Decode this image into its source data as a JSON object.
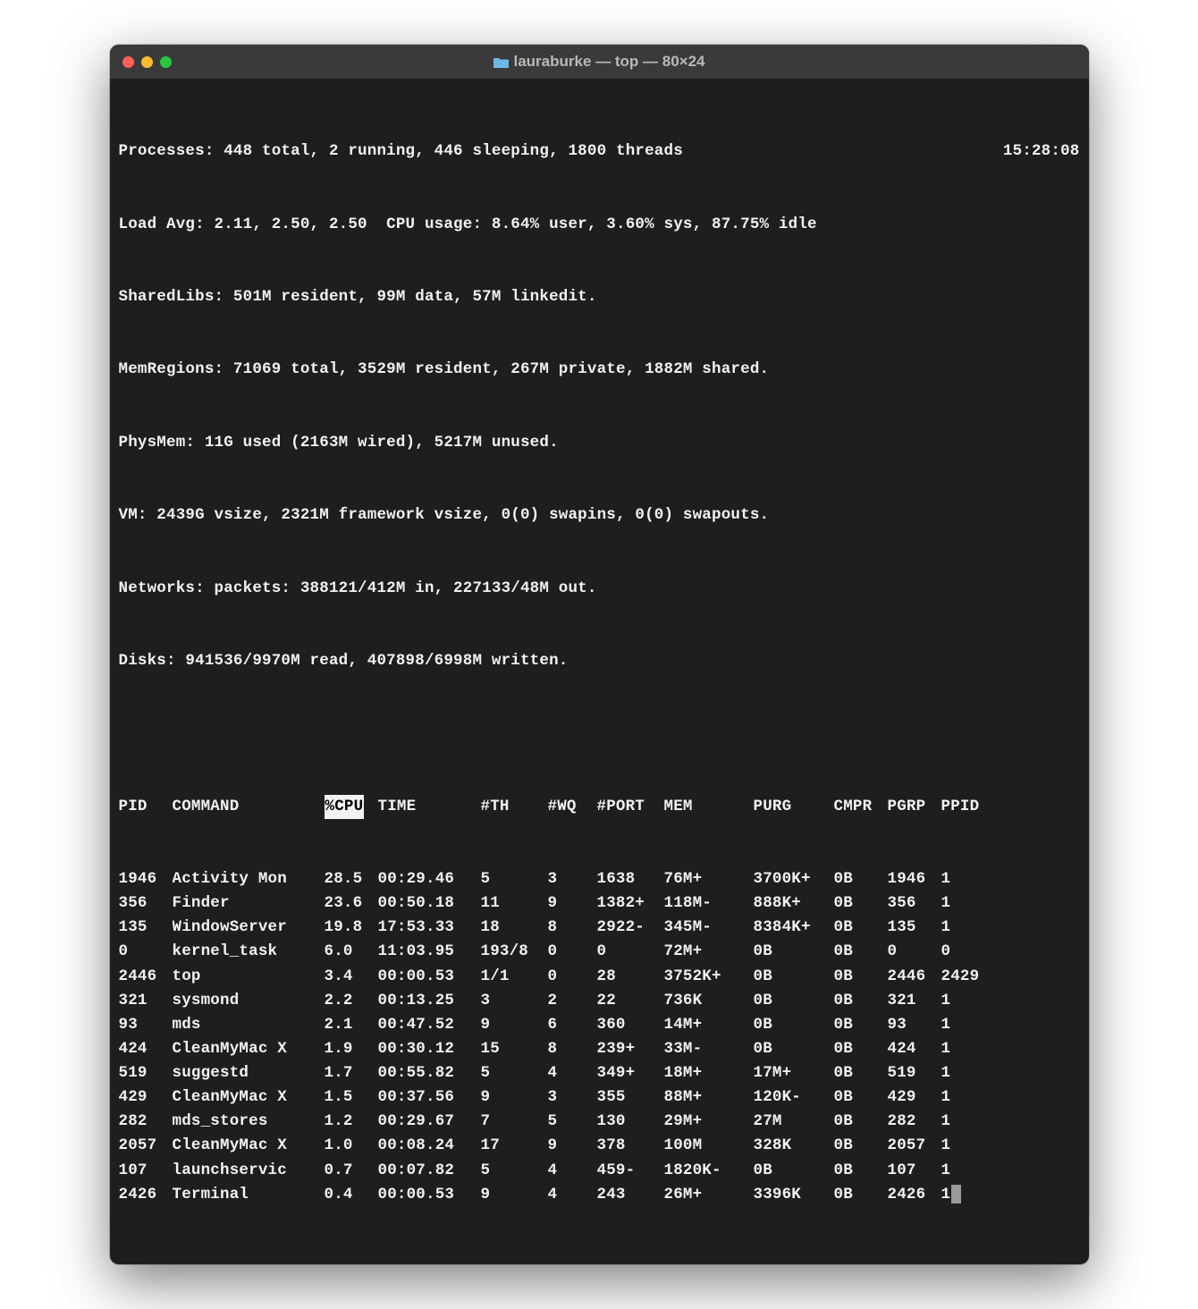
{
  "window": {
    "title": "lauraburke — top — 80×24"
  },
  "summary": {
    "processes": "Processes: 448 total, 2 running, 446 sleeping, 1800 threads",
    "clock": "15:28:08",
    "line2": "Load Avg: 2.11, 2.50, 2.50  CPU usage: 8.64% user, 3.60% sys, 87.75% idle",
    "line3": "SharedLibs: 501M resident, 99M data, 57M linkedit.",
    "line4": "MemRegions: 71069 total, 3529M resident, 267M private, 1882M shared.",
    "line5": "PhysMem: 11G used (2163M wired), 5217M unused.",
    "line6": "VM: 2439G vsize, 2321M framework vsize, 0(0) swapins, 0(0) swapouts.",
    "line7": "Networks: packets: 388121/412M in, 227133/48M out.",
    "line8": "Disks: 941536/9970M read, 407898/6998M written."
  },
  "headers": {
    "pid": "PID",
    "cmd": "COMMAND",
    "cpu": "%CPU",
    "time": "TIME",
    "th": "#TH",
    "wq": "#WQ",
    "port": "#PORT",
    "mem": "MEM",
    "purg": "PURG",
    "cmpr": "CMPR",
    "pgrp": "PGRP",
    "ppid": "PPID"
  },
  "rows": [
    {
      "pid": "1946",
      "cmd": "Activity Mon",
      "cpu": "28.5",
      "time": "00:29.46",
      "th": "5",
      "wq": "3",
      "port": "1638",
      "mem": "76M+",
      "purg": "3700K+",
      "cmpr": "0B",
      "pgrp": "1946",
      "ppid": "1"
    },
    {
      "pid": "356",
      "cmd": "Finder",
      "cpu": "23.6",
      "time": "00:50.18",
      "th": "11",
      "wq": "9",
      "port": "1382+",
      "mem": "118M-",
      "purg": "888K+",
      "cmpr": "0B",
      "pgrp": "356",
      "ppid": "1"
    },
    {
      "pid": "135",
      "cmd": "WindowServer",
      "cpu": "19.8",
      "time": "17:53.33",
      "th": "18",
      "wq": "8",
      "port": "2922-",
      "mem": "345M-",
      "purg": "8384K+",
      "cmpr": "0B",
      "pgrp": "135",
      "ppid": "1"
    },
    {
      "pid": "0",
      "cmd": "kernel_task",
      "cpu": "6.0",
      "time": "11:03.95",
      "th": "193/8",
      "wq": "0",
      "port": "0",
      "mem": "72M+",
      "purg": "0B",
      "cmpr": "0B",
      "pgrp": "0",
      "ppid": "0"
    },
    {
      "pid": "2446",
      "cmd": "top",
      "cpu": "3.4",
      "time": "00:00.53",
      "th": "1/1",
      "wq": "0",
      "port": "28",
      "mem": "3752K+",
      "purg": "0B",
      "cmpr": "0B",
      "pgrp": "2446",
      "ppid": "2429"
    },
    {
      "pid": "321",
      "cmd": "sysmond",
      "cpu": "2.2",
      "time": "00:13.25",
      "th": "3",
      "wq": "2",
      "port": "22",
      "mem": "736K",
      "purg": "0B",
      "cmpr": "0B",
      "pgrp": "321",
      "ppid": "1"
    },
    {
      "pid": "93",
      "cmd": "mds",
      "cpu": "2.1",
      "time": "00:47.52",
      "th": "9",
      "wq": "6",
      "port": "360",
      "mem": "14M+",
      "purg": "0B",
      "cmpr": "0B",
      "pgrp": "93",
      "ppid": "1"
    },
    {
      "pid": "424",
      "cmd": "CleanMyMac X",
      "cpu": "1.9",
      "time": "00:30.12",
      "th": "15",
      "wq": "8",
      "port": "239+",
      "mem": "33M-",
      "purg": "0B",
      "cmpr": "0B",
      "pgrp": "424",
      "ppid": "1"
    },
    {
      "pid": "519",
      "cmd": "suggestd",
      "cpu": "1.7",
      "time": "00:55.82",
      "th": "5",
      "wq": "4",
      "port": "349+",
      "mem": "18M+",
      "purg": "17M+",
      "cmpr": "0B",
      "pgrp": "519",
      "ppid": "1"
    },
    {
      "pid": "429",
      "cmd": "CleanMyMac X",
      "cpu": "1.5",
      "time": "00:37.56",
      "th": "9",
      "wq": "3",
      "port": "355",
      "mem": "88M+",
      "purg": "120K-",
      "cmpr": "0B",
      "pgrp": "429",
      "ppid": "1"
    },
    {
      "pid": "282",
      "cmd": "mds_stores",
      "cpu": "1.2",
      "time": "00:29.67",
      "th": "7",
      "wq": "5",
      "port": "130",
      "mem": "29M+",
      "purg": "27M",
      "cmpr": "0B",
      "pgrp": "282",
      "ppid": "1"
    },
    {
      "pid": "2057",
      "cmd": "CleanMyMac X",
      "cpu": "1.0",
      "time": "00:08.24",
      "th": "17",
      "wq": "9",
      "port": "378",
      "mem": "100M",
      "purg": "328K",
      "cmpr": "0B",
      "pgrp": "2057",
      "ppid": "1"
    },
    {
      "pid": "107",
      "cmd": "launchservic",
      "cpu": "0.7",
      "time": "00:07.82",
      "th": "5",
      "wq": "4",
      "port": "459-",
      "mem": "1820K-",
      "purg": "0B",
      "cmpr": "0B",
      "pgrp": "107",
      "ppid": "1"
    },
    {
      "pid": "2426",
      "cmd": "Terminal",
      "cpu": "0.4",
      "time": "00:00.53",
      "th": "9",
      "wq": "4",
      "port": "243",
      "mem": "26M+",
      "purg": "3396K",
      "cmpr": "0B",
      "pgrp": "2426",
      "ppid": "1"
    }
  ]
}
